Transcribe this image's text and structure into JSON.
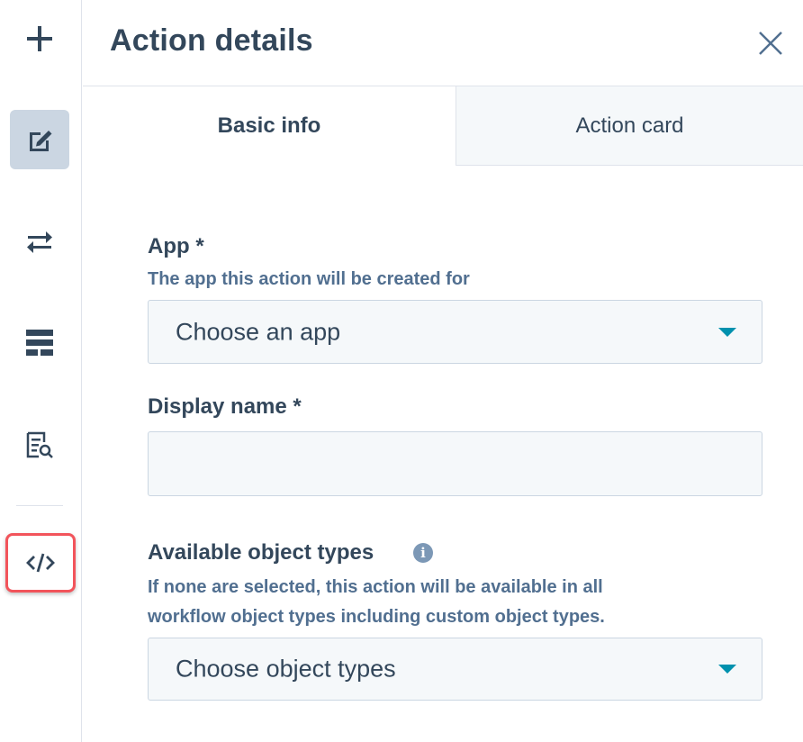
{
  "rail": {
    "items": [
      {
        "icon": "plus-icon"
      },
      {
        "icon": "edit-icon",
        "active": true
      },
      {
        "icon": "swap-arrows-icon"
      },
      {
        "icon": "layout-icon"
      },
      {
        "icon": "document-search-icon"
      },
      {
        "icon": "code-icon",
        "highlighted": true
      }
    ]
  },
  "header": {
    "title": "Action details"
  },
  "tabs": [
    {
      "label": "Basic info",
      "active": true
    },
    {
      "label": "Action card",
      "active": false
    }
  ],
  "form": {
    "app": {
      "label": "App *",
      "help": "The app this action will be created for",
      "placeholder": "Choose an app"
    },
    "display_name": {
      "label": "Display name *",
      "value": ""
    },
    "object_types": {
      "label": "Available object types",
      "help_line1": "If none are selected, this action will be available in all",
      "help_line2": "workflow object types including custom object types.",
      "placeholder": "Choose object types"
    }
  },
  "colors": {
    "text": "#33475b",
    "help": "#516f90",
    "caret": "#0091ae",
    "highlight_border": "#f2545b",
    "active_rail_bg": "#cbd6e2",
    "field_bg": "#f5f8fa"
  }
}
